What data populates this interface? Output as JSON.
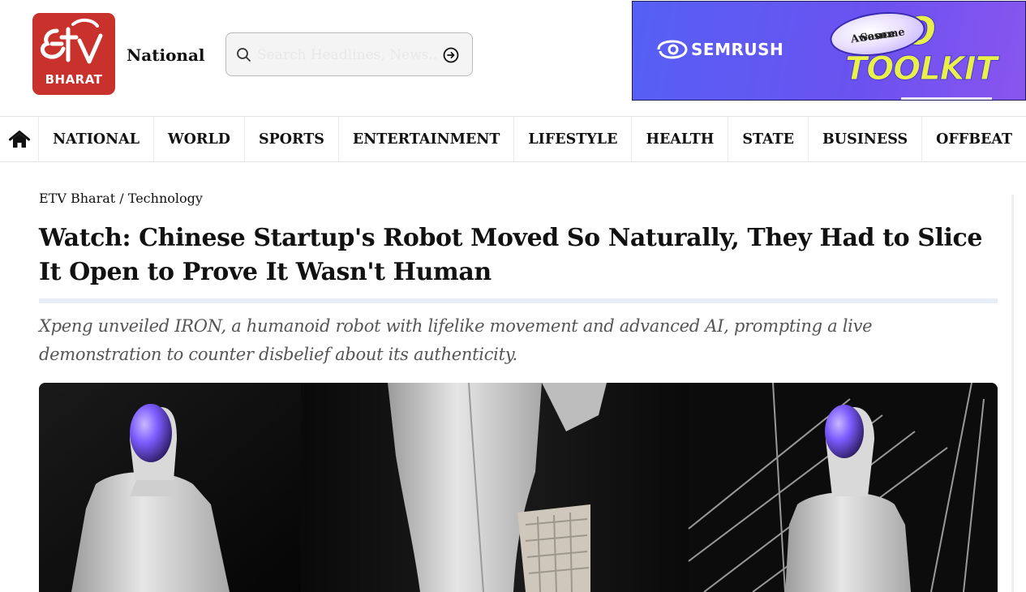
{
  "header": {
    "logo_text": "BHARAT",
    "logo_brand": "ETV",
    "edition": "National",
    "search": {
      "placeholder": "Search Headlines, News..."
    }
  },
  "ad": {
    "brand": "SEMRUSH",
    "badge_line1": "Awesome",
    "badge_line2": "Sauce",
    "headline_1": "SEO",
    "headline_2": "TOOLKIT"
  },
  "nav": {
    "items": [
      {
        "label": "NATIONAL"
      },
      {
        "label": "WORLD"
      },
      {
        "label": "SPORTS"
      },
      {
        "label": "ENTERTAINMENT"
      },
      {
        "label": "LIFESTYLE"
      },
      {
        "label": "HEALTH"
      },
      {
        "label": "STATE"
      },
      {
        "label": "BUSINESS"
      },
      {
        "label": "OFFBEAT"
      }
    ]
  },
  "article": {
    "breadcrumb": {
      "home": "ETV Bharat",
      "separator": " / ",
      "section": "Technology"
    },
    "title": "Watch: Chinese Startup's Robot Moved So Naturally, They Had to Slice It Open to Prove It Wasn't Human",
    "summary": "Xpeng unveiled IRON, a humanoid robot with lifelike movement and advanced AI, prompting a live demonstration to counter disbelief about its authenticity."
  },
  "colors": {
    "brand_red": "#c8312c",
    "ad_blue": "#5560f5",
    "ad_yellow": "#e9f04a",
    "visor_purple": "#7b5cff"
  }
}
